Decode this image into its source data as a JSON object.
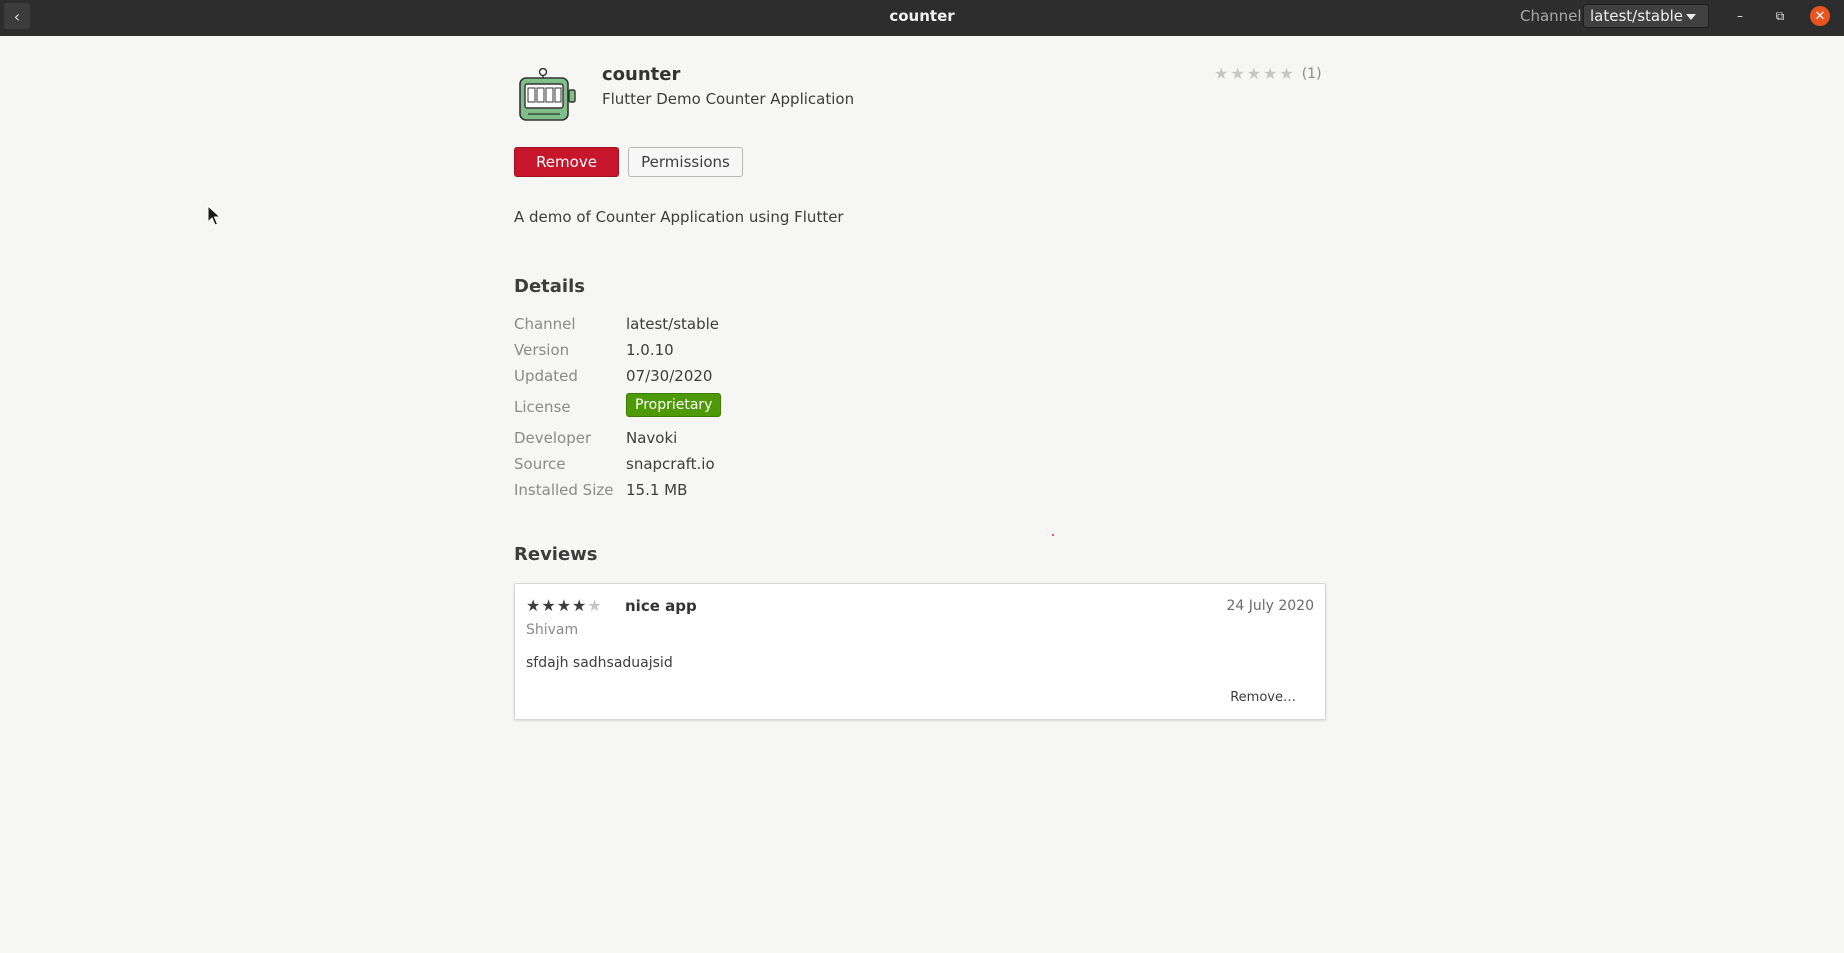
{
  "header": {
    "title": "counter",
    "channel_label": "Channel",
    "channel_value": "latest/stable",
    "back_glyph": "‹",
    "minimize_glyph": "–",
    "maximize_glyph": "⧉",
    "close_glyph": "✕"
  },
  "app": {
    "name": "counter",
    "summary": "Flutter Demo Counter Application",
    "rating_count": "(1)",
    "description": "A demo of Counter Application using Flutter",
    "icon": "counter-app-icon"
  },
  "actions": {
    "remove_label": "Remove",
    "permissions_label": "Permissions"
  },
  "details": {
    "title": "Details",
    "rows": [
      {
        "key": "Channel",
        "value": "latest/stable"
      },
      {
        "key": "Version",
        "value": "1.0.10"
      },
      {
        "key": "Updated",
        "value": "07/30/2020"
      },
      {
        "key": "License",
        "value": "Proprietary"
      },
      {
        "key": "Developer",
        "value": "Navoki"
      },
      {
        "key": "Source",
        "value": "snapcraft.io"
      },
      {
        "key": "Installed Size",
        "value": "15.1 MB"
      }
    ]
  },
  "reviews": {
    "title": "Reviews",
    "items": [
      {
        "rating": 4,
        "title": "nice app",
        "date": "24 July 2020",
        "author": "Shivam",
        "text": "sfdajh sadhsaduajsid",
        "remove_label": "Remove…"
      }
    ]
  },
  "colors": {
    "header_bg": "#2d2d2d",
    "remove_button": "#c7162b",
    "license_badge": "#4e9a06",
    "close_button": "#e95420"
  }
}
